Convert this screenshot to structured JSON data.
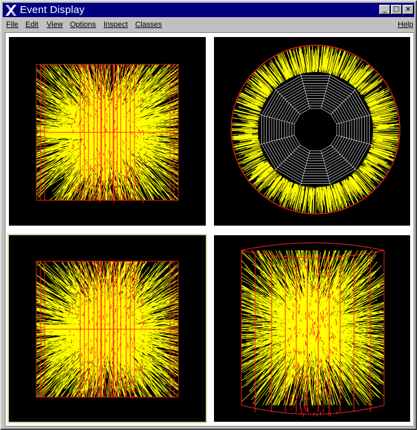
{
  "window": {
    "title": "Event Display"
  },
  "titlebar_buttons": {
    "minimize": "_",
    "maximize": "□",
    "close": "×"
  },
  "menu": {
    "file": "File",
    "edit": "Edit",
    "view": "View",
    "options": "Options",
    "inspect": "Inspect",
    "classes": "Classes",
    "help": "Help"
  },
  "colors": {
    "tracks": "#ffff00",
    "detector": "#ff2020",
    "background": "#000000",
    "title_bar": "#000080"
  },
  "views": [
    {
      "id": "side-view-top-left"
    },
    {
      "id": "end-view-top-right"
    },
    {
      "id": "side-view-bottom-left"
    },
    {
      "id": "perspective-view-bottom-right"
    }
  ]
}
